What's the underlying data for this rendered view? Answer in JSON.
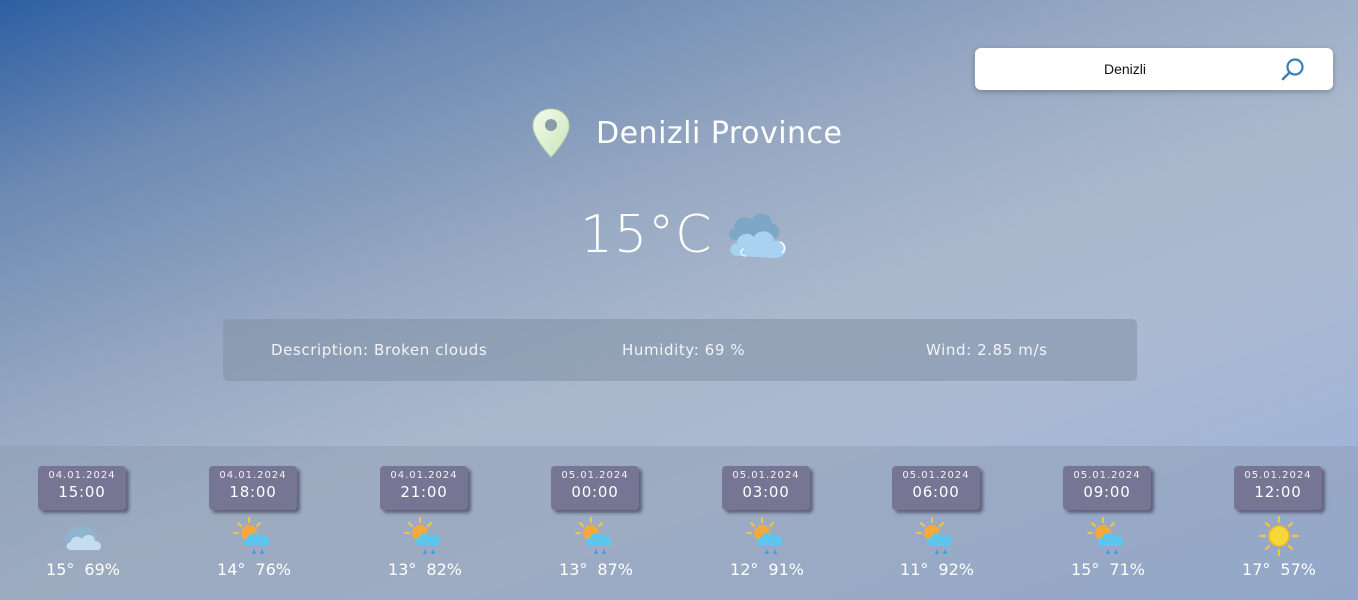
{
  "search": {
    "value": "Denizli"
  },
  "location": {
    "name": "Denizli Province"
  },
  "current": {
    "temperature": "15°C",
    "icon": "broken-clouds-icon",
    "description": "Description: Broken clouds",
    "humidity": "Humidity: 69 %",
    "wind": "Wind: 2.85 m/s"
  },
  "forecast": [
    {
      "date": "04.01.2024",
      "time": "15:00",
      "temp": "15°",
      "humidity": "69%",
      "icon": "clouds-icon"
    },
    {
      "date": "04.01.2024",
      "time": "18:00",
      "temp": "14°",
      "humidity": "76%",
      "icon": "sun-rain-icon"
    },
    {
      "date": "04.01.2024",
      "time": "21:00",
      "temp": "13°",
      "humidity": "82%",
      "icon": "sun-rain-icon"
    },
    {
      "date": "05.01.2024",
      "time": "00:00",
      "temp": "13°",
      "humidity": "87%",
      "icon": "sun-rain-icon"
    },
    {
      "date": "05.01.2024",
      "time": "03:00",
      "temp": "12°",
      "humidity": "91%",
      "icon": "sun-rain-icon"
    },
    {
      "date": "05.01.2024",
      "time": "06:00",
      "temp": "11°",
      "humidity": "92%",
      "icon": "sun-rain-icon"
    },
    {
      "date": "05.01.2024",
      "time": "09:00",
      "temp": "15°",
      "humidity": "71%",
      "icon": "sun-rain-icon"
    },
    {
      "date": "05.01.2024",
      "time": "12:00",
      "temp": "17°",
      "humidity": "57%",
      "icon": "sun-icon"
    }
  ]
}
